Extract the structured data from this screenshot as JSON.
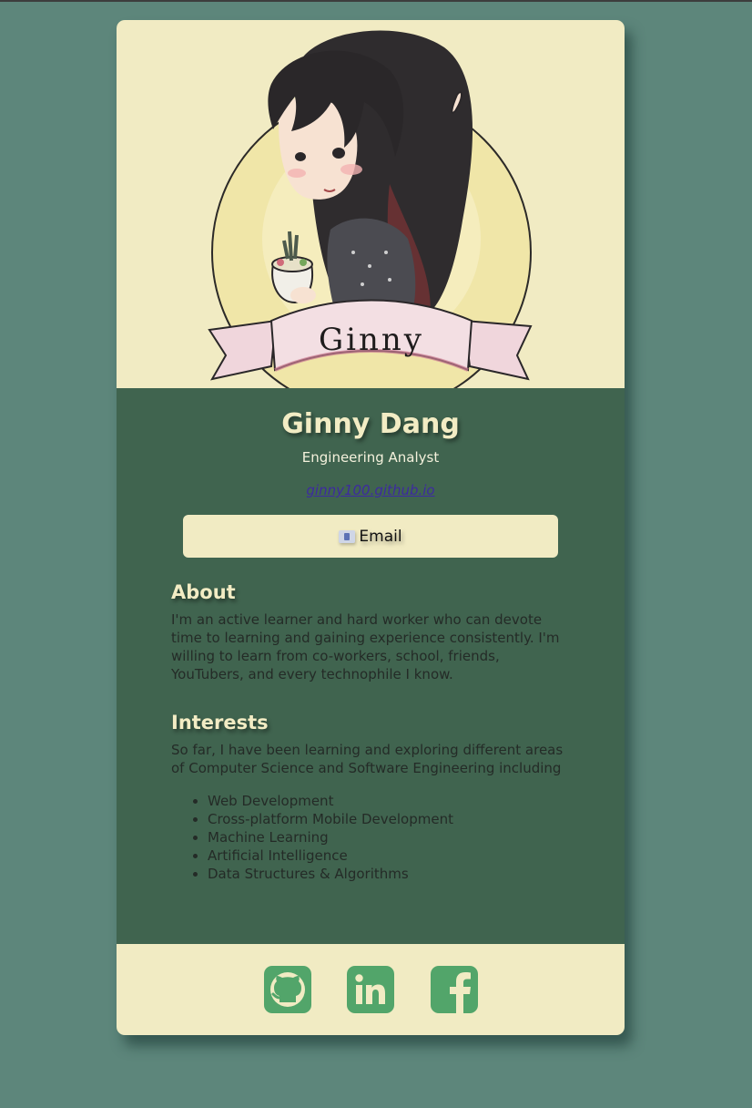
{
  "profile": {
    "name": "Ginny Dang",
    "role": "Engineering Analyst",
    "website": "ginny100.github.io",
    "email_label": "Email",
    "portrait_banner_text": "Ginny"
  },
  "about": {
    "title": "About",
    "text": "I'm an active learner and hard worker who can devote time to learning and gaining experience consistently. I'm willing to learn from co-workers, school, friends, YouTubers, and every technophile I know."
  },
  "interests": {
    "title": "Interests",
    "intro": "So far, I have been learning and exploring different areas of Computer Science and Software Engineering including",
    "items": [
      "Web Development",
      "Cross-platform Mobile Development",
      "Machine Learning",
      "Artificial Intelligence",
      "Data Structures & Algorithms"
    ]
  },
  "social": [
    {
      "icon": "github-icon"
    },
    {
      "icon": "linkedin-icon"
    },
    {
      "icon": "facebook-icon"
    }
  ],
  "colors": {
    "page_background": "#5d867b",
    "cream": "#f1ebc3",
    "card_green": "#40644f",
    "social_green": "#52a56a",
    "link": "#3d2aa0"
  }
}
